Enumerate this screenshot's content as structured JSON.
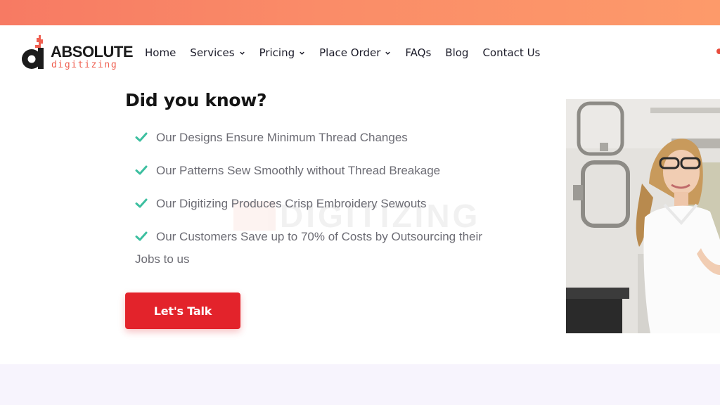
{
  "brand": {
    "name": "ABSOLUTE",
    "tagline": "digitizing",
    "accent": "#ef5f50"
  },
  "nav": {
    "items": [
      {
        "label": "Home",
        "dropdown": false
      },
      {
        "label": "Services",
        "dropdown": true
      },
      {
        "label": "Pricing",
        "dropdown": true
      },
      {
        "label": "Place Order",
        "dropdown": true
      },
      {
        "label": "FAQs",
        "dropdown": false
      },
      {
        "label": "Blog",
        "dropdown": false
      },
      {
        "label": "Contact Us",
        "dropdown": false
      }
    ]
  },
  "section": {
    "heading": "Did you know?",
    "features": [
      "Our Designs Ensure Minimum Thread Changes",
      "Our Patterns Sew Smoothly without Thread Breakage",
      "Our Digitizing Produces Crisp Embroidery Sewouts",
      "Our Customers Save up to 70% of Costs by Outsourcing their Jobs to us"
    ],
    "cta_label": "Let's Talk",
    "watermark_text": "DIGITIZING"
  },
  "colors": {
    "top_strip_start": "#f77a63",
    "top_strip_end": "#fd9a6a",
    "check": "#3dbfa0",
    "cta": "#e3232b",
    "bottom_band": "#f7f4fd"
  },
  "icons": {
    "check": "checkmark-icon",
    "chevron": "chevron-down-icon"
  }
}
